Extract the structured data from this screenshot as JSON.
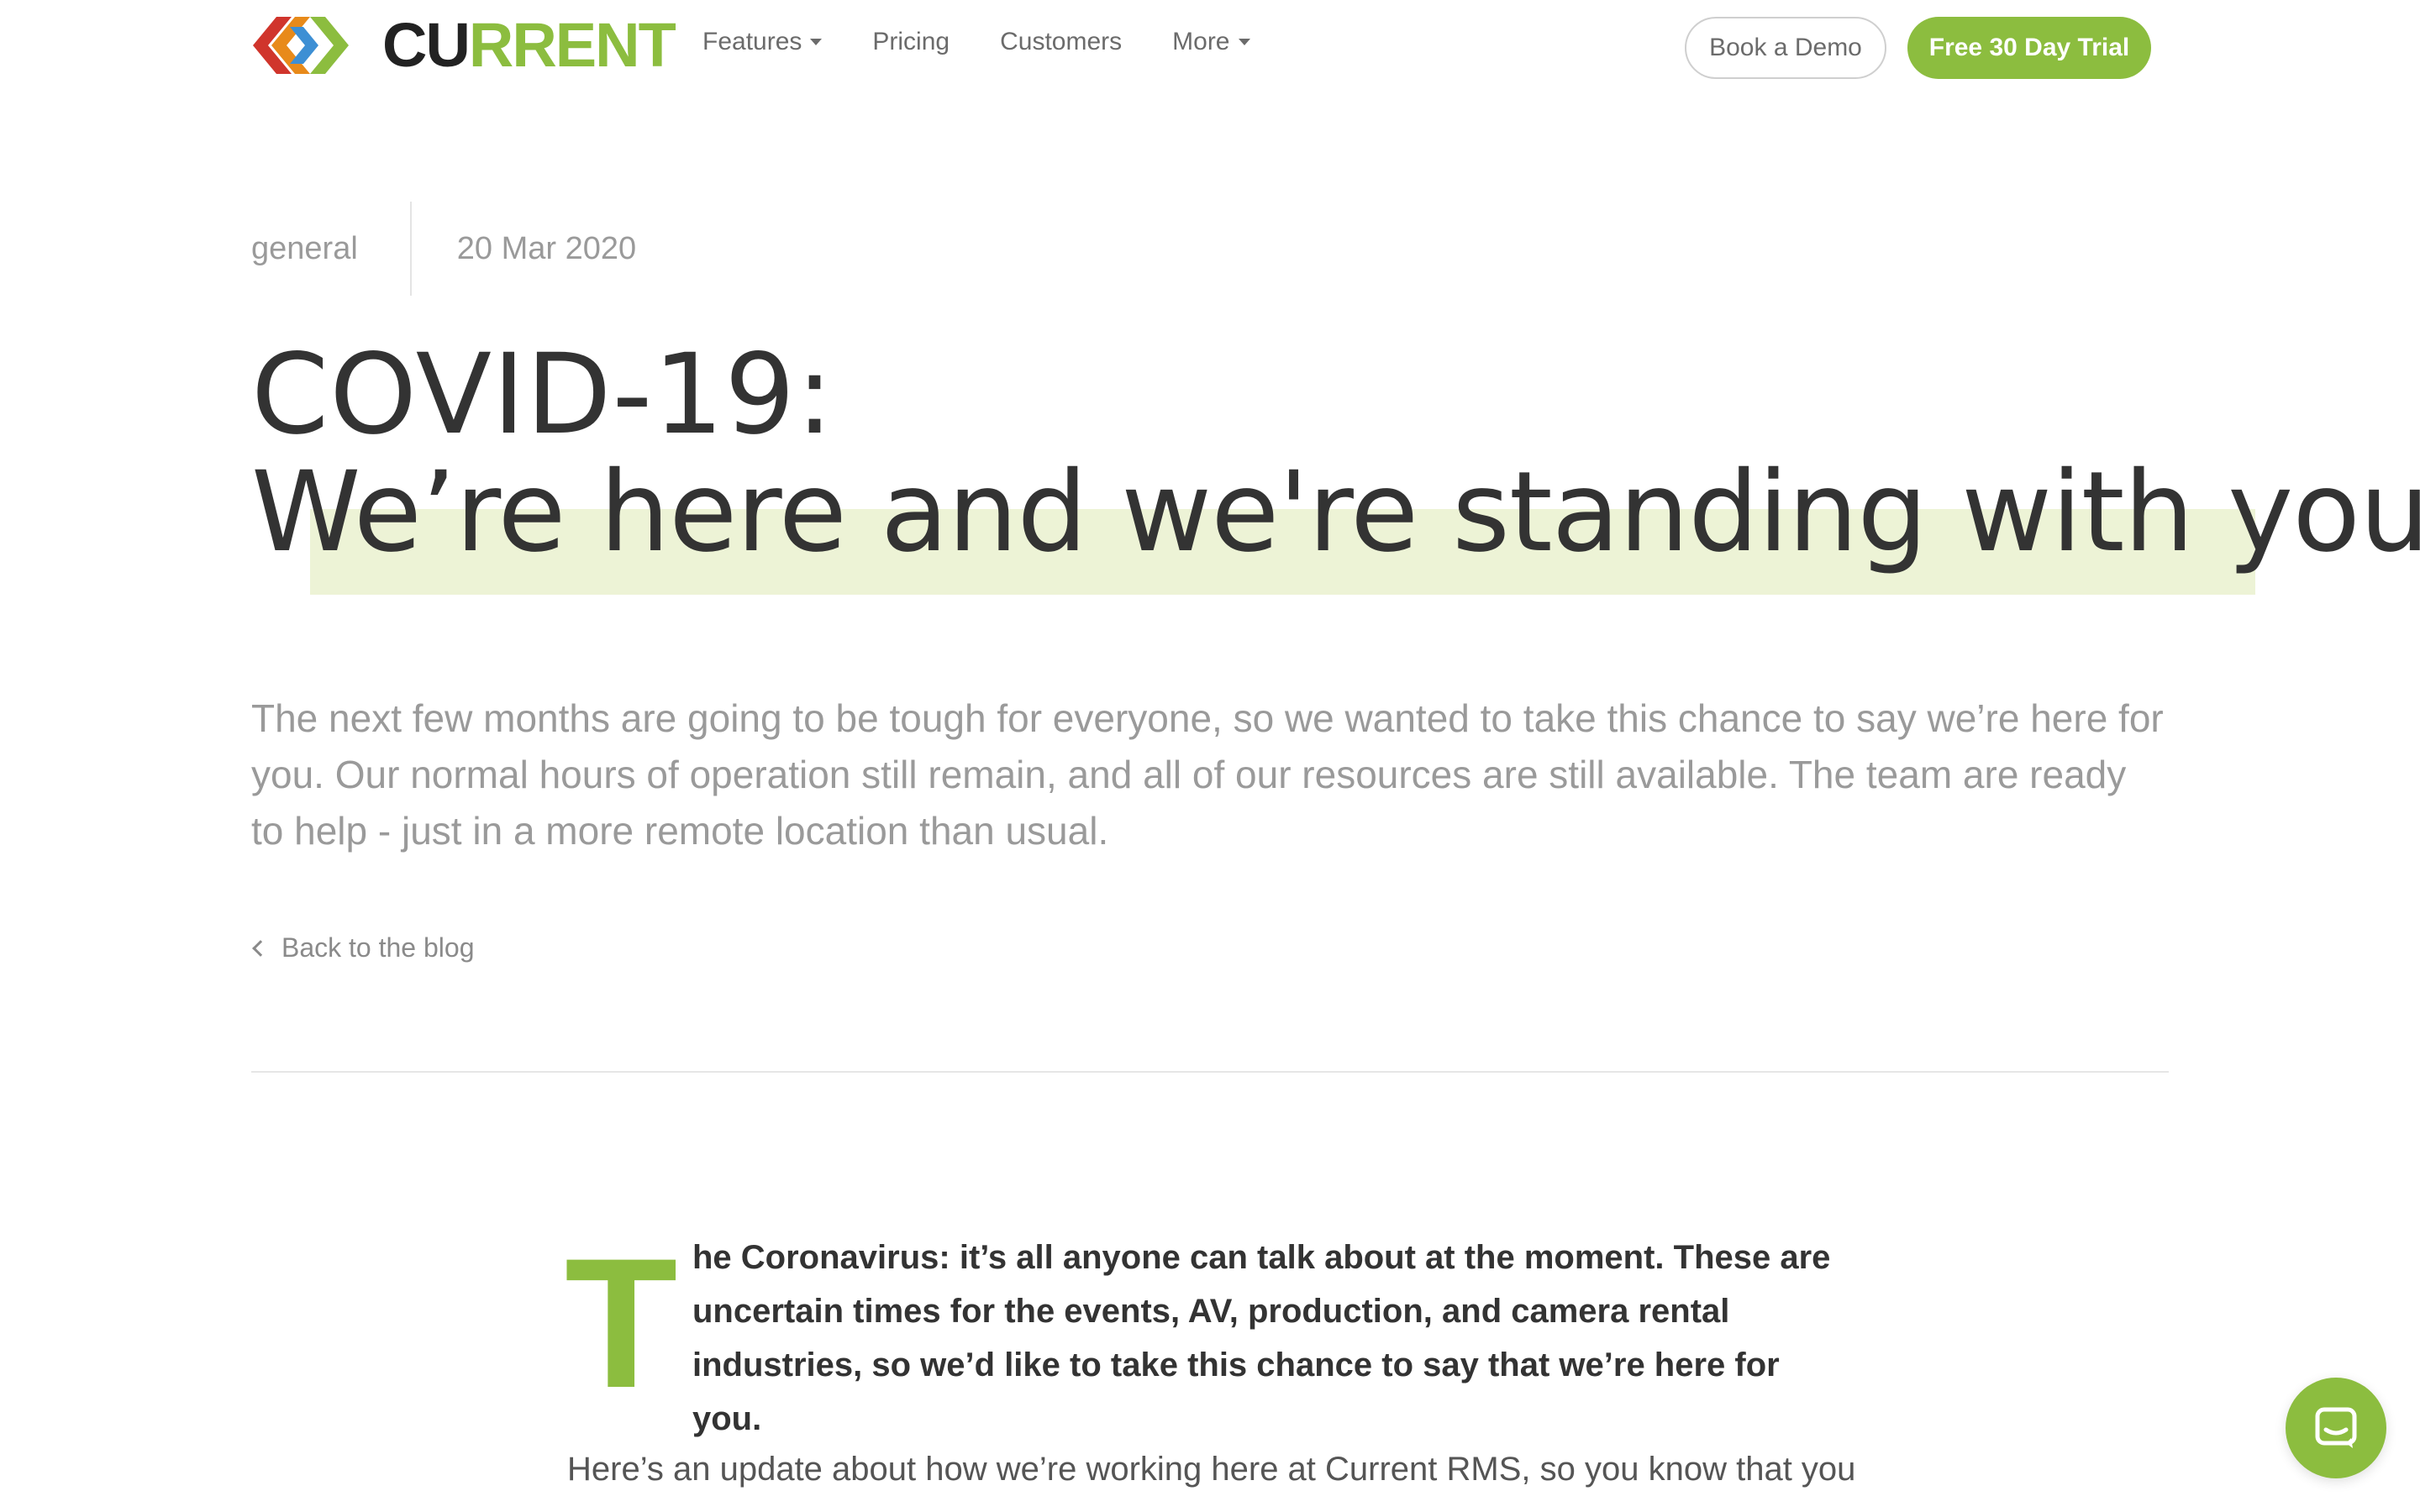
{
  "brand": {
    "logo_prefix": "CU",
    "logo_suffix": "RRENT",
    "accent_color": "#8cbd3f",
    "logo_icon": "interlocking-chevrons-logo-icon"
  },
  "nav": {
    "items": [
      {
        "label": "Features",
        "has_dropdown": true
      },
      {
        "label": "Pricing",
        "has_dropdown": false
      },
      {
        "label": "Customers",
        "has_dropdown": false
      },
      {
        "label": "More",
        "has_dropdown": true
      }
    ]
  },
  "header_actions": {
    "demo_label": "Book a Demo",
    "trial_label": "Free 30 Day Trial"
  },
  "post": {
    "category": "general",
    "date": "20 Mar 2020",
    "title_line1": "COVID-19:",
    "title_line2": "We’re here and we're standing with you",
    "intro": "The next few months are going to be tough for everyone, so we wanted to take this chance to say we’re here for you. Our normal hours of operation still remain, and all of our resources are still available. The team are ready to help - just in a more remote location than usual.",
    "back_label": "Back to the blog",
    "dropcap": "T",
    "para1": "he Coronavirus: it’s all anyone can talk about at the moment. These are uncertain times for the events, AV, production, and camera rental industries, so we’d like to take this chance to say that we’re here for you.",
    "para2": "Here’s an update about how we’re working here at Current RMS, so you know that you can"
  },
  "chat": {
    "icon": "chat-bubble-icon"
  }
}
